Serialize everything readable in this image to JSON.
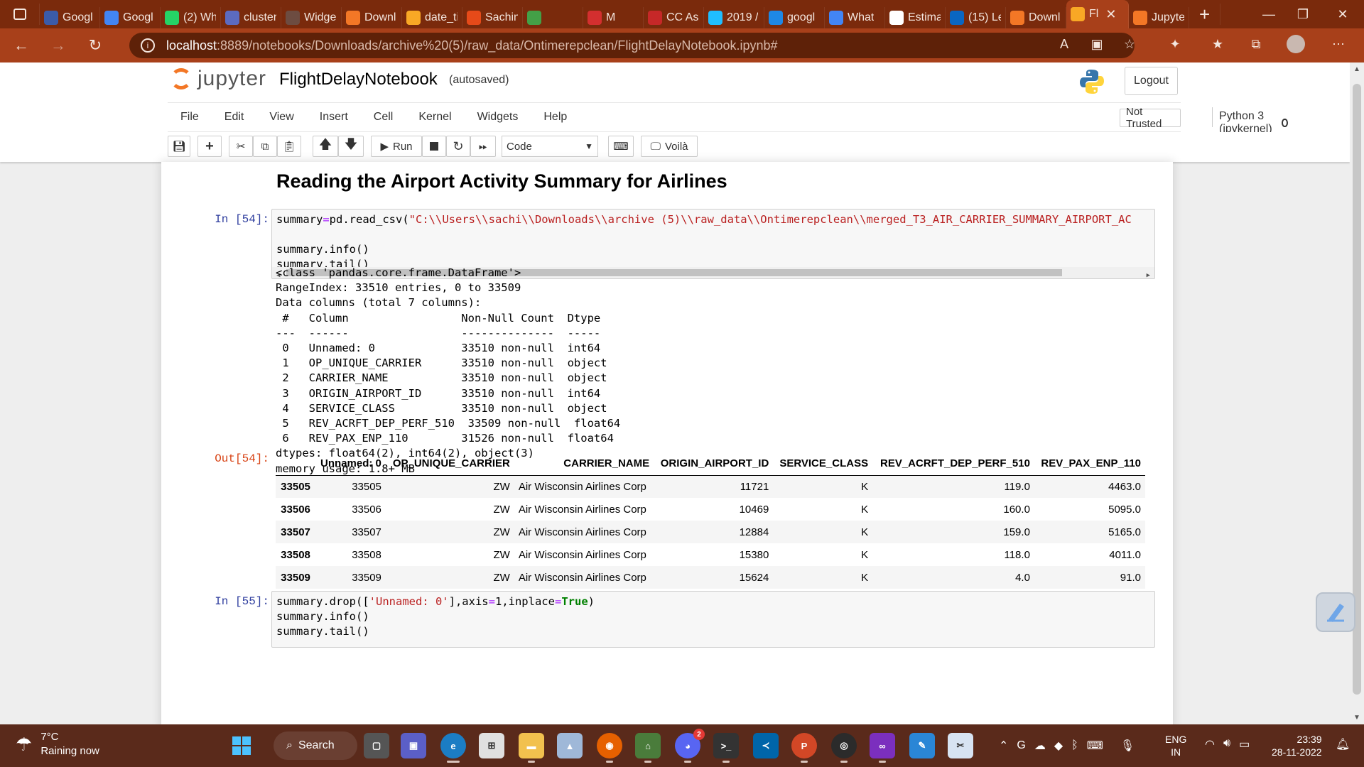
{
  "browser": {
    "tabs": [
      {
        "label": "Googl",
        "icon": "account-icon",
        "color": "#3b5ba9"
      },
      {
        "label": "Googl",
        "icon": "docs-icon",
        "color": "#4285f4"
      },
      {
        "label": "(2) Wh",
        "icon": "whatsapp-icon",
        "color": "#25d366"
      },
      {
        "label": "cluster",
        "icon": "gear-icon",
        "color": "#5c6bc0"
      },
      {
        "label": "Widge",
        "icon": "grid-icon",
        "color": "#6d4c41"
      },
      {
        "label": "Downl",
        "icon": "jupyter-icon",
        "color": "#f37726"
      },
      {
        "label": "date_ti",
        "icon": "notebook-icon",
        "color": "#f9a825"
      },
      {
        "label": "Sachin",
        "icon": "fox-icon",
        "color": "#e64a19"
      },
      {
        "label": "",
        "icon": "image-icon",
        "color": "#43a047"
      },
      {
        "label": "M",
        "icon": "record-icon",
        "color": "#d32f2f"
      },
      {
        "label": "CC As",
        "icon": "pdf-icon",
        "color": "#c62828"
      },
      {
        "label": "2019 /",
        "icon": "kaggle-icon",
        "color": "#20beff"
      },
      {
        "label": "googl",
        "icon": "search-icon",
        "color": "#1e88e5"
      },
      {
        "label": "What",
        "icon": "google-icon",
        "color": "#4285f4"
      },
      {
        "label": "Estima",
        "icon": "docs-icon",
        "color": "#ffffff"
      },
      {
        "label": "(15) Le",
        "icon": "linkedin-icon",
        "color": "#0a66c2"
      },
      {
        "label": "Downl",
        "icon": "jupyter-icon",
        "color": "#f37726"
      },
      {
        "label": "Fl",
        "icon": "notebook-icon",
        "color": "#f9a825",
        "active": true
      },
      {
        "label": "Jupyte",
        "icon": "jupyter-icon",
        "color": "#f37726"
      }
    ],
    "new_tab": "+",
    "url_host": "localhost",
    "url_path": ":8889/notebooks/Downloads/archive%20(5)/raw_data/Ontimerepclean/FlightDelayNotebook.ipynb#"
  },
  "jupyter": {
    "logo_text": "jupyter",
    "notebook_name": "FlightDelayNotebook",
    "autosave_status": "(autosaved)",
    "logout": "Logout",
    "menu": [
      "File",
      "Edit",
      "View",
      "Insert",
      "Cell",
      "Kernel",
      "Widgets",
      "Help"
    ],
    "not_trusted": "Not Trusted",
    "kernel": "Python 3 (ipykernel)",
    "toolbar": {
      "run": "Run",
      "cell_type": "Code",
      "voila": "Voilà"
    }
  },
  "notebook": {
    "heading": "Reading the Airport Activity Summary for Airlines",
    "cell1": {
      "prompt": "In [54]:",
      "code_prefix": "summary",
      "code_op": "=",
      "code_call": "pd.read_csv(",
      "code_string": "\"C:\\\\Users\\\\sachi\\\\Downloads\\\\archive (5)\\\\raw_data\\\\Ontimerepclean\\\\merged_T3_AIR_CARRIER_SUMMARY_AIRPORT_AC",
      "line3": "summary.info()",
      "line4": "summary.tail()",
      "stdout": "<class 'pandas.core.frame.DataFrame'>\nRangeIndex: 33510 entries, 0 to 33509\nData columns (total 7 columns):\n #   Column                 Non-Null Count  Dtype  \n---  ------                 --------------  -----  \n 0   Unnamed: 0             33510 non-null  int64  \n 1   OP_UNIQUE_CARRIER      33510 non-null  object \n 2   CARRIER_NAME           33510 non-null  object \n 3   ORIGIN_AIRPORT_ID      33510 non-null  int64  \n 4   SERVICE_CLASS          33510 non-null  object \n 5   REV_ACRFT_DEP_PERF_510  33509 non-null  float64\n 6   REV_PAX_ENP_110        31526 non-null  float64\ndtypes: float64(2), int64(2), object(3)\nmemory usage: 1.8+ MB",
      "out_prompt": "Out[54]:",
      "table": {
        "columns": [
          "",
          "Unnamed: 0",
          "OP_UNIQUE_CARRIER",
          "CARRIER_NAME",
          "ORIGIN_AIRPORT_ID",
          "SERVICE_CLASS",
          "REV_ACRFT_DEP_PERF_510",
          "REV_PAX_ENP_110"
        ],
        "rows": [
          [
            "33505",
            "33505",
            "ZW",
            "Air Wisconsin Airlines Corp",
            "11721",
            "K",
            "119.0",
            "4463.0"
          ],
          [
            "33506",
            "33506",
            "ZW",
            "Air Wisconsin Airlines Corp",
            "10469",
            "K",
            "160.0",
            "5095.0"
          ],
          [
            "33507",
            "33507",
            "ZW",
            "Air Wisconsin Airlines Corp",
            "12884",
            "K",
            "159.0",
            "5165.0"
          ],
          [
            "33508",
            "33508",
            "ZW",
            "Air Wisconsin Airlines Corp",
            "15380",
            "K",
            "118.0",
            "4011.0"
          ],
          [
            "33509",
            "33509",
            "ZW",
            "Air Wisconsin Airlines Corp",
            "15624",
            "K",
            "4.0",
            "91.0"
          ]
        ]
      }
    },
    "cell2": {
      "prompt": "In [55]:",
      "line1_a": "summary.drop([",
      "line1_s": "'Unnamed: 0'",
      "line1_b": "],axis",
      "line1_o": "=",
      "line1_c": "1,inplace",
      "line1_o2": "=",
      "line1_k": "True",
      "line1_d": ")",
      "line2": "summary.info()",
      "line3": "summary.tail()"
    }
  },
  "taskbar": {
    "temperature": "7°C",
    "weather": "Raining now",
    "search": "Search",
    "lang1": "ENG",
    "lang2": "IN",
    "time": "23:39",
    "date": "28-11-2022",
    "discord_badge": "2"
  }
}
